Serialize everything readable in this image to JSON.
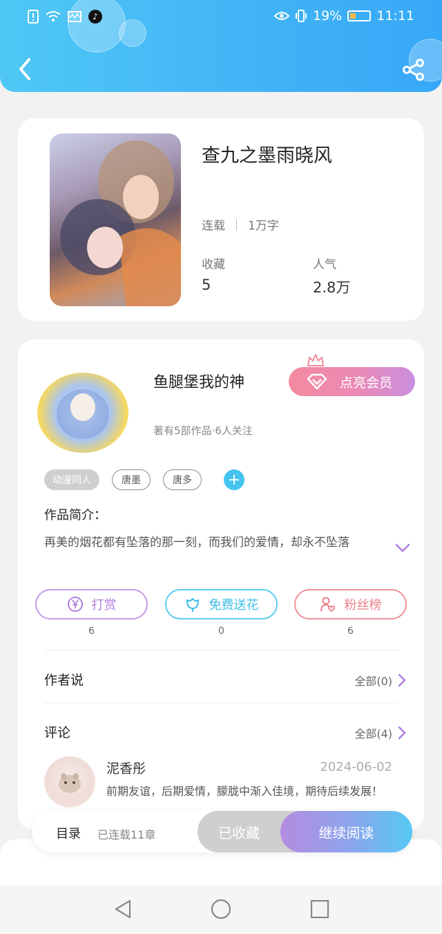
{
  "status_bar": {
    "battery_percent": "19%",
    "time": "11:11",
    "tiktok_glyph": "♪"
  },
  "header": {
    "back_icon": "chevron-left-icon",
    "share_icon": "share-icon"
  },
  "book": {
    "title": "查九之墨雨晓风",
    "status": "连载",
    "word_count": "1万字",
    "favorites_label": "收藏",
    "favorites_value": "5",
    "popularity_label": "人气",
    "popularity_value": "2.8万"
  },
  "author": {
    "name": "鱼腿堡我的神",
    "subtitle": "著有5部作品·6人关注",
    "vip_button": "点亮会员"
  },
  "tags": [
    "动漫同人",
    "唐墨",
    "唐多"
  ],
  "intro": {
    "title": "作品简介：",
    "text": "再美的烟花都有坠落的那一刻，而我们的爱情，却永不坠落"
  },
  "actions": [
    {
      "label": "打赏",
      "count": "6",
      "icon": "yen-icon"
    },
    {
      "label": "免费送花",
      "count": "0",
      "icon": "flower-icon"
    },
    {
      "label": "粉丝榜",
      "count": "6",
      "icon": "fans-heart-icon"
    }
  ],
  "author_says": {
    "title": "作者说",
    "more": "全部(0)"
  },
  "comments": {
    "title": "评论",
    "more": "全部(4)",
    "items": [
      {
        "user": "泥香彤",
        "date": "2024-06-02",
        "text": "前期友谊，后期爱情，朦胧中渐入佳境，期待后续发展！"
      }
    ]
  },
  "bottom_bar": {
    "toc": "目录",
    "toc_sub": "已连载11章",
    "collected": "已收藏",
    "continue": "继续阅读"
  },
  "colors": {
    "header_blue": "#43b6f6",
    "accent_cyan": "#45c4f0",
    "accent_purple": "#b58be0",
    "vip_pink": "#f58aa0"
  }
}
